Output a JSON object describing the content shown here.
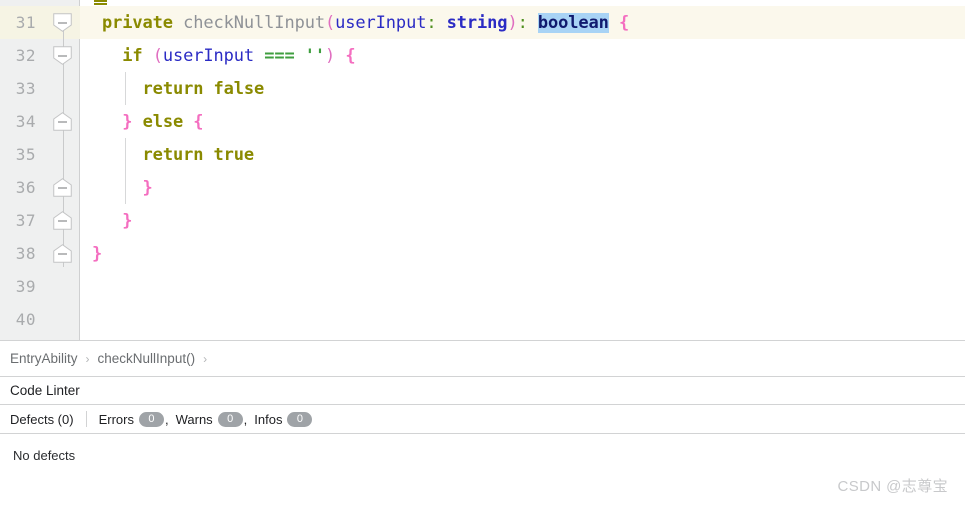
{
  "editor": {
    "current_line": 31,
    "selection_text": "boolean",
    "accent_selection_color": "#a8d3f5",
    "current_line_color": "#fbf8ec",
    "lines": [
      {
        "number": "31",
        "fold": "collapse-down",
        "indent_guides": []
      },
      {
        "number": "32",
        "fold": "collapse-down",
        "indent_guides": []
      },
      {
        "number": "33",
        "fold": "none",
        "indent_guides": [
          125
        ]
      },
      {
        "number": "34",
        "fold": "collapse-up",
        "indent_guides": []
      },
      {
        "number": "35",
        "fold": "none",
        "indent_guides": [
          125
        ]
      },
      {
        "number": "36",
        "fold": "collapse-up",
        "indent_guides": [
          125
        ]
      },
      {
        "number": "37",
        "fold": "collapse-up",
        "indent_guides": []
      },
      {
        "number": "38",
        "fold": "collapse-up",
        "indent_guides": []
      },
      {
        "number": "39",
        "fold": "none",
        "indent_guides": []
      },
      {
        "number": "40",
        "fold": "none",
        "indent_guides": []
      }
    ],
    "code": {
      "l31": {
        "kw_private": "private",
        "fn_name": "checkNullInput",
        "paren_open": "(",
        "param_name": "userInput",
        "colon1": ":",
        "param_type": "string",
        "paren_close": ")",
        "colon2": ":",
        "return_type": "boolean",
        "brace_open": "{"
      },
      "l32": {
        "kw_if": "if",
        "paren_open": "(",
        "var_name": "userInput",
        "operator": "===",
        "string_lit": "''",
        "paren_close": ")",
        "brace_open": "{"
      },
      "l33": {
        "kw_return": "return",
        "value": "false"
      },
      "l34": {
        "brace_close": "}",
        "kw_else": "else",
        "brace_open": "{"
      },
      "l35": {
        "kw_return": "return",
        "value": "true"
      },
      "l36": {
        "brace_close": "}"
      },
      "l37": {
        "brace_close": "}"
      },
      "l38": {
        "brace_close": "}"
      },
      "l39": {
        "text": ""
      },
      "l40": {
        "text": ""
      }
    }
  },
  "breadcrumb": {
    "items": [
      "EntryAbility",
      "checkNullInput()"
    ],
    "separator": "›",
    "trailing_separator": "›"
  },
  "linter": {
    "title": "Code Linter",
    "defects_label": "Defects (0)",
    "counters": [
      {
        "name": "Errors",
        "count": "0"
      },
      {
        "name": "Warns",
        "count": "0"
      },
      {
        "name": "Infos",
        "count": "0"
      }
    ],
    "comma": ",",
    "badge_color": "#9fa3a7",
    "empty_message": "No defects"
  },
  "watermark": {
    "text": "CSDN @志尊宝"
  }
}
